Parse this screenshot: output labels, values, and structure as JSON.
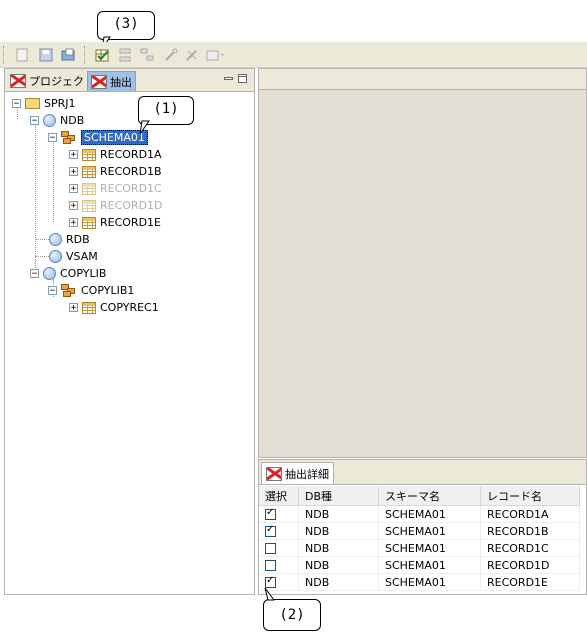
{
  "callouts": {
    "c3": "(3)",
    "c1": "(1)",
    "c2": "(2)"
  },
  "tabs": {
    "project": "プロジェクト",
    "extract": "抽出"
  },
  "tree": {
    "root": "SPRJ1",
    "ndb": "NDB",
    "schema01": "SCHEMA01",
    "records": [
      "RECORD1A",
      "RECORD1B",
      "RECORD1C",
      "RECORD1D",
      "RECORD1E"
    ],
    "rdb": "RDB",
    "vsam": "VSAM",
    "copylib": "COPYLIB",
    "copylib1": "COPYLIB1",
    "copyrec1": "COPYREC1"
  },
  "detail": {
    "tab_label": "抽出詳細",
    "columns": [
      "選択",
      "DB種",
      "スキーマ名",
      "レコード名"
    ],
    "rows": [
      {
        "checked": true,
        "db": "NDB",
        "schema": "SCHEMA01",
        "record": "RECORD1A"
      },
      {
        "checked": true,
        "db": "NDB",
        "schema": "SCHEMA01",
        "record": "RECORD1B"
      },
      {
        "checked": false,
        "db": "NDB",
        "schema": "SCHEMA01",
        "record": "RECORD1C"
      },
      {
        "checked": false,
        "db": "NDB",
        "schema": "SCHEMA01",
        "record": "RECORD1D"
      },
      {
        "checked": true,
        "db": "NDB",
        "schema": "SCHEMA01",
        "record": "RECORD1E"
      }
    ]
  },
  "toolbar_icons": [
    "new-icon",
    "save-icon",
    "import-icon",
    "extract-check-icon",
    "hierarchy-icon",
    "tree-icon",
    "tool-icon",
    "tool2-icon",
    "export-icon"
  ]
}
